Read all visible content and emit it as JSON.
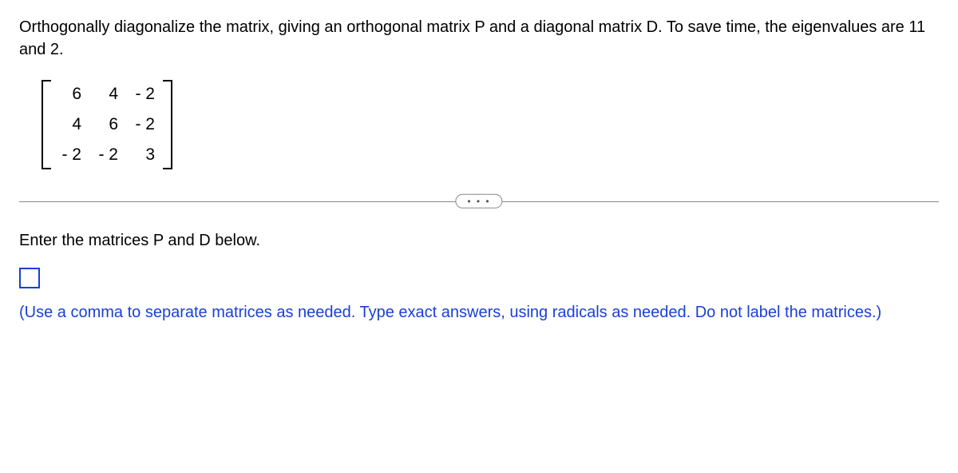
{
  "question": {
    "prompt": "Orthogonally diagonalize the matrix, giving an orthogonal matrix P and a diagonal matrix D. To save time, the eigenvalues are 11 and 2.",
    "matrix": {
      "r0c0": "6",
      "r0c1": "4",
      "r0c2": "- 2",
      "r1c0": "4",
      "r1c1": "6",
      "r1c2": "- 2",
      "r2c0": "- 2",
      "r2c1": "- 2",
      "r2c2": "3"
    }
  },
  "divider": {
    "dots": "• • •"
  },
  "answer": {
    "instruction": "Enter the matrices P and D below.",
    "hint": "(Use a comma to separate matrices as needed. Type exact answers, using radicals as needed. Do not label the matrices.)"
  }
}
